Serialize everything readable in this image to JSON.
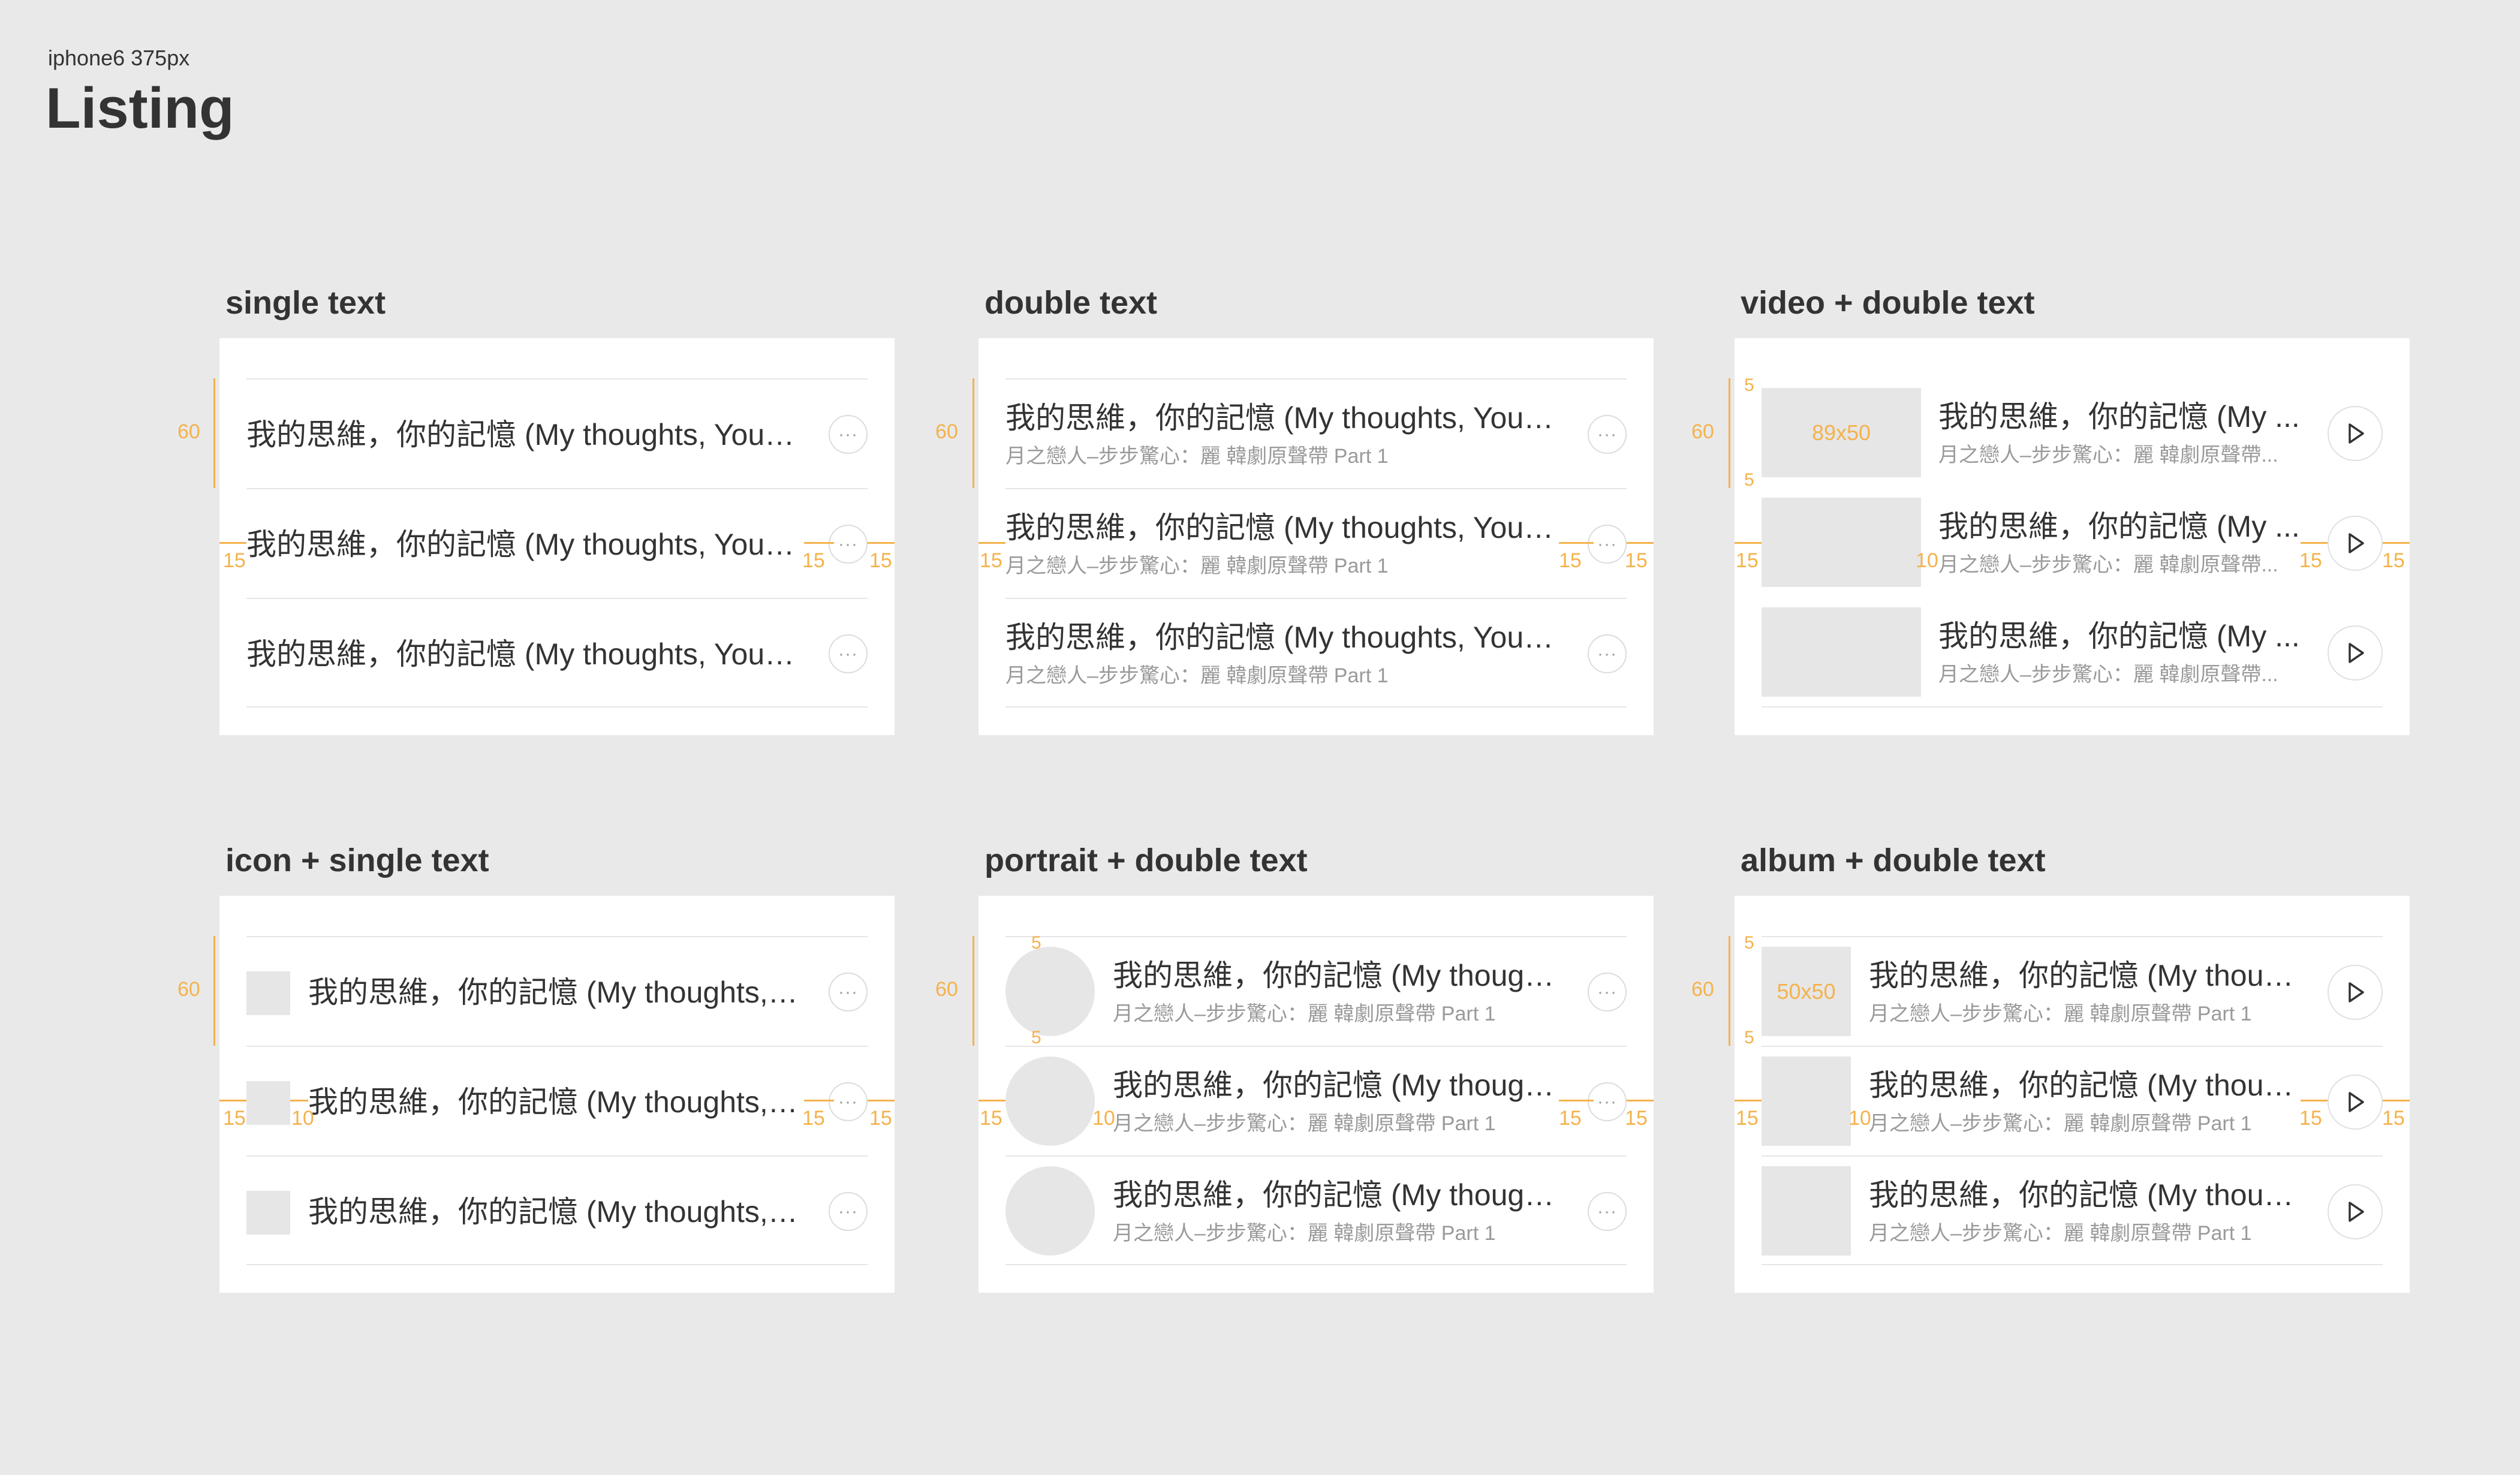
{
  "header": {
    "subtitle": "iphone6  375px",
    "title": "Listing"
  },
  "row_title": "我的思維，你的記憶 (My thoughts, Your ...",
  "row_subtitle": "月之戀人–步步驚心：麗 韓劇原聲帶 Part 1",
  "annotations": {
    "height": "60",
    "pad": "15",
    "gap": "10",
    "five": "5",
    "video_thumb": "89x50",
    "album_thumb": "50x50"
  },
  "sections": {
    "single_text": {
      "title": "single text",
      "row_title": "我的思維，你的記憶 (My thoughts, Your ..."
    },
    "double_text": {
      "title": "double text",
      "row_title": "我的思維，你的記憶 (My thoughts, Your ...",
      "row_subtitle": "月之戀人–步步驚心：麗 韓劇原聲帶 Part 1"
    },
    "video_double": {
      "title": "video + double text",
      "row_title": "我的思維，你的記憶 (My ...",
      "row_subtitle": "月之戀人–步步驚心：麗 韓劇原聲帶..."
    },
    "icon_single": {
      "title": "icon + single text",
      "row_title": "我的思維，你的記憶 (My thoughts, ..."
    },
    "portrait_double": {
      "title": "portrait + double text",
      "row_title": "我的思維，你的記憶 (My though...",
      "row_subtitle": "月之戀人–步步驚心：麗 韓劇原聲帶 Part 1"
    },
    "album_double": {
      "title": "album + double text",
      "row_title": "我的思維，你的記憶 (My thoug...",
      "row_subtitle": "月之戀人–步步驚心：麗 韓劇原聲帶 Part 1"
    }
  },
  "icons": {
    "more": "more-icon",
    "play": "play-icon"
  },
  "colors": {
    "background": "#e9e9e9",
    "annotation": "#f4b24c",
    "placeholder": "#e6e6e6"
  },
  "more_glyph": "···"
}
